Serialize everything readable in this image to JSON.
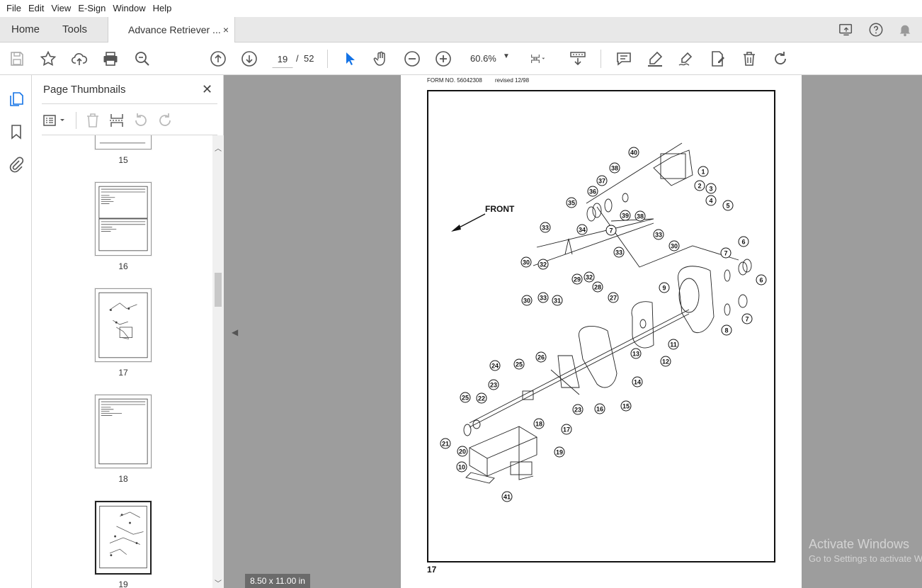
{
  "menu": [
    "File",
    "Edit",
    "View",
    "E-Sign",
    "Window",
    "Help"
  ],
  "tabs": {
    "home": "Home",
    "tools": "Tools",
    "document": "Advance Retriever ...",
    "close_glyph": "×"
  },
  "toolbar": {
    "current_page": "19",
    "separator": "/",
    "total_pages": "52",
    "zoom": "60.6%"
  },
  "thumbnail_panel": {
    "title": "Page Thumbnails",
    "close_glyph": "✕",
    "pages": [
      {
        "label": "15"
      },
      {
        "label": "16"
      },
      {
        "label": "17"
      },
      {
        "label": "18"
      },
      {
        "label": "19",
        "selected": true
      }
    ]
  },
  "document": {
    "form_no": "FORM NO. 56042308",
    "revised": "revised 12/98",
    "page_footer": "17",
    "front_label": "FRONT",
    "callouts": [
      "1",
      "2",
      "3",
      "4",
      "5",
      "6",
      "7",
      "8",
      "9",
      "10",
      "11",
      "12",
      "13",
      "14",
      "15",
      "16",
      "17",
      "18",
      "19",
      "20",
      "21",
      "22",
      "23",
      "24",
      "25",
      "26",
      "27",
      "28",
      "29",
      "30",
      "31",
      "32",
      "33",
      "34",
      "35",
      "36",
      "37",
      "38",
      "39",
      "40",
      "41"
    ],
    "page_size": "8.50 x 11.00 in"
  },
  "watermark": {
    "line1": "Activate Windows",
    "line2": "Go to Settings to activate Windows."
  },
  "colors": {
    "doc_background": "#9d9d9d",
    "accent_cursor": "#1473e6"
  }
}
